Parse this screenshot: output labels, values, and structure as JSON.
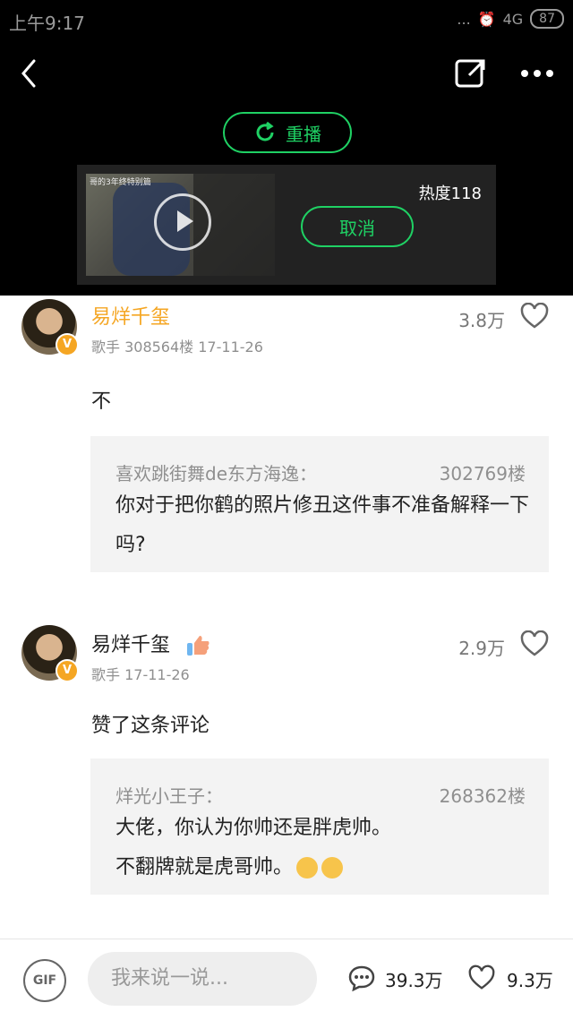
{
  "status": {
    "time": "上午9:17",
    "signal": "4G",
    "battery": "87",
    "dots": "..."
  },
  "header": {
    "replay_label": "重播",
    "cancel_label": "取消",
    "heat": "热度118",
    "video_caption": "哥的3年终特别篇"
  },
  "comments": [
    {
      "name": "易烊千玺",
      "name_color": "#f5a623",
      "meta": "歌手   308564楼   17-11-26",
      "likes": "3.8万",
      "text": "不",
      "quote": {
        "name": "喜欢跳街舞de东方海逸：",
        "floor": "302769楼",
        "text": "你对于把你鹤的照片修丑这件事不准备解释一下吗?"
      }
    },
    {
      "name": "易烊千玺",
      "name_color": "#222222",
      "meta": "歌手   17-11-26",
      "likes": "2.9万",
      "text": "赞了这条评论",
      "quote": {
        "name": "烊光小王子：",
        "floor": "268362楼",
        "text_line1": "大佬，你认为你帅还是胖虎帅。",
        "text_line2": "不翻牌就是虎哥帅。"
      }
    }
  ],
  "bottom": {
    "gif_label": "GIF",
    "placeholder": "我来说一说...",
    "comments_count": "39.3万",
    "likes_count": "9.3万"
  },
  "colors": {
    "accent": "#1fd164",
    "badge": "#f5a623"
  }
}
